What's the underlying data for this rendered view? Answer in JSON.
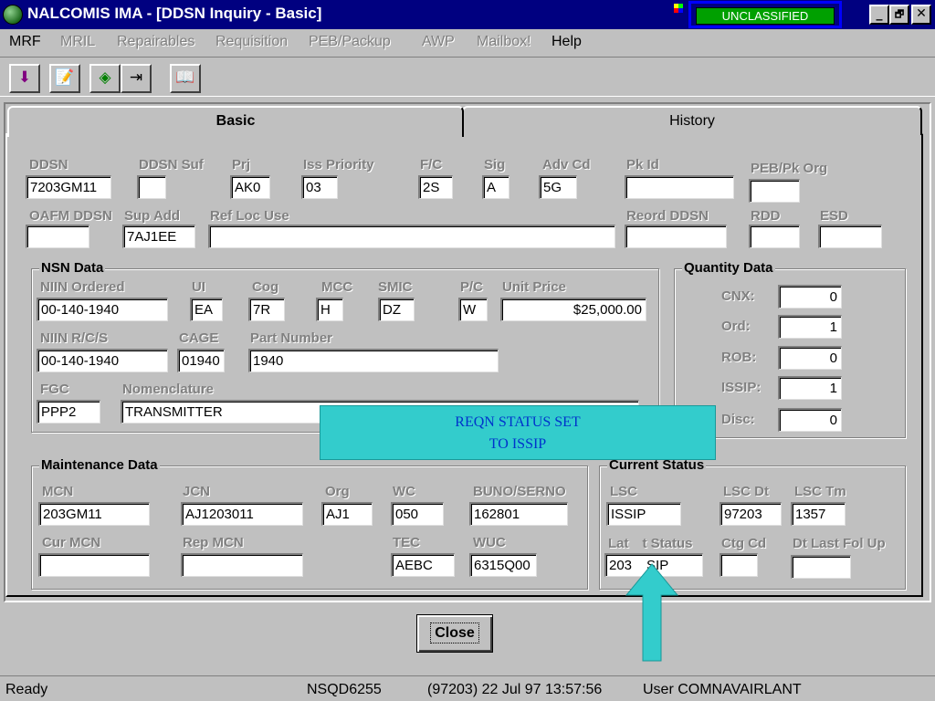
{
  "window": {
    "title": "NALCOMIS IMA - [DDSN Inquiry - Basic]",
    "classification": "UNCLASSIFIED",
    "minimize": "_",
    "maximize": "🗗",
    "close": "✕"
  },
  "menu": {
    "items": [
      {
        "label": "MRF",
        "enabled": true
      },
      {
        "label": "MRIL",
        "enabled": false
      },
      {
        "label": "Repairables",
        "enabled": false
      },
      {
        "label": "Requisition",
        "enabled": false
      },
      {
        "label": "PEB/Packup",
        "enabled": false
      },
      {
        "label": "AWP",
        "enabled": false
      },
      {
        "label": "Mailbox!",
        "enabled": false
      },
      {
        "label": "Help",
        "enabled": true
      }
    ]
  },
  "toolbar": {
    "icons": [
      "arrow-down-icon",
      "notepad-icon",
      "globe-icon",
      "exit-door-icon",
      "book-icon"
    ]
  },
  "tabs": {
    "basic": "Basic",
    "history": "History"
  },
  "header": {
    "ddsn": {
      "label": "DDSN",
      "value": "7203GM11"
    },
    "ddsn_suf": {
      "label": "DDSN Suf",
      "value": ""
    },
    "prj": {
      "label": "Prj",
      "value": "AK0"
    },
    "iss_priority": {
      "label": "Iss Priority",
      "value": "03"
    },
    "fc": {
      "label": "F/C",
      "value": "2S"
    },
    "sig": {
      "label": "Sig",
      "value": "A"
    },
    "adv_cd": {
      "label": "Adv Cd",
      "value": "5G"
    },
    "pk_id": {
      "label": "Pk Id",
      "value": ""
    },
    "peb_pk_org": {
      "label": "PEB/Pk Org",
      "value": ""
    },
    "oafm_ddsn": {
      "label": "OAFM DDSN",
      "value": ""
    },
    "sup_add": {
      "label": "Sup Add",
      "value": "7AJ1EE"
    },
    "ref_loc_use": {
      "label": "Ref Loc Use",
      "value": ""
    },
    "reord_ddsn": {
      "label": "Reord DDSN",
      "value": ""
    },
    "rdd": {
      "label": "RDD",
      "value": ""
    },
    "esd": {
      "label": "ESD",
      "value": ""
    }
  },
  "nsn": {
    "title": "NSN Data",
    "niin_ordered": {
      "label": "NIIN Ordered",
      "value": "00-140-1940"
    },
    "ui": {
      "label": "UI",
      "value": "EA"
    },
    "cog": {
      "label": "Cog",
      "value": "7R"
    },
    "mcc": {
      "label": "MCC",
      "value": "H"
    },
    "smic": {
      "label": "SMIC",
      "value": "DZ"
    },
    "pc": {
      "label": "P/C",
      "value": "W"
    },
    "unit_price": {
      "label": "Unit Price",
      "value": "$25,000.00"
    },
    "niin_rcs": {
      "label": "NIIN R/C/S",
      "value": "00-140-1940"
    },
    "cage": {
      "label": "CAGE",
      "value": "01940"
    },
    "part_number": {
      "label": "Part Number",
      "value": "1940"
    },
    "fgc": {
      "label": "FGC",
      "value": "PPP2"
    },
    "nomenclature": {
      "label": "Nomenclature",
      "value": "TRANSMITTER"
    }
  },
  "quantity": {
    "title": "Quantity Data",
    "cnx": {
      "label": "CNX:",
      "value": "0"
    },
    "ord": {
      "label": "Ord:",
      "value": "1"
    },
    "rob": {
      "label": "ROB:",
      "value": "0"
    },
    "issip": {
      "label": "ISSIP:",
      "value": "1"
    },
    "disc": {
      "label": "Disc:",
      "value": "0"
    }
  },
  "maintenance": {
    "title": "Maintenance Data",
    "mcn": {
      "label": "MCN",
      "value": "203GM11"
    },
    "jcn": {
      "label": "JCN",
      "value": "AJ1203011"
    },
    "org": {
      "label": "Org",
      "value": "AJ1"
    },
    "wc": {
      "label": "WC",
      "value": "050"
    },
    "buno": {
      "label": "BUNO/SERNO",
      "value": "162801"
    },
    "cur_mcn": {
      "label": "Cur MCN",
      "value": ""
    },
    "rep_mcn": {
      "label": "Rep MCN",
      "value": ""
    },
    "tec": {
      "label": "TEC",
      "value": "AEBC"
    },
    "wuc": {
      "label": "WUC",
      "value": "6315Q00"
    }
  },
  "current_status": {
    "title": "Current Status",
    "lsc": {
      "label": "LSC",
      "value": "ISSIP"
    },
    "lsc_dt": {
      "label": "LSC Dt",
      "value": "97203"
    },
    "lsc_tm": {
      "label": "LSC Tm",
      "value": "1357"
    },
    "latest_status_label_a": "Lat",
    "latest_status_label_b": "t Status",
    "latest_status_value_a": "203",
    "latest_status_value_b": "SIP",
    "ctg_cd": {
      "label": "Ctg Cd",
      "value": ""
    },
    "dt_last_fol_up": {
      "label": "Dt Last Fol Up",
      "value": ""
    }
  },
  "close_button": "Close",
  "callout": {
    "line1": "REQN  STATUS SET",
    "line2": "TO ISSIP",
    "color": "#33cccc"
  },
  "statusbar": {
    "state": "Ready",
    "server": "NSQD6255",
    "datetime": "(97203)  22 Jul 97  13:57:56",
    "user": "User COMNAVAIRLANT"
  }
}
